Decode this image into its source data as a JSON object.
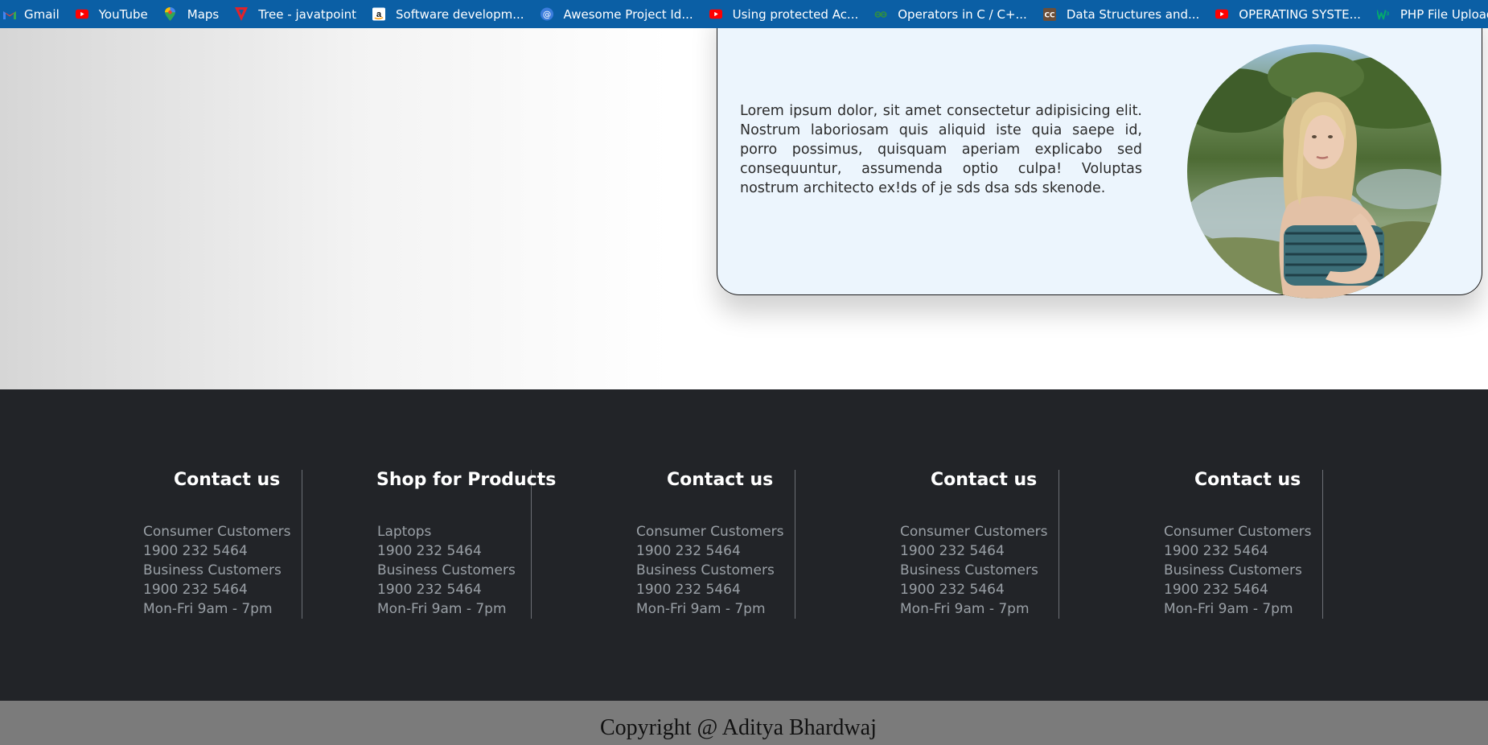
{
  "bookmarks": [
    {
      "label": "Gmail",
      "icon": "gmail-icon"
    },
    {
      "label": "YouTube",
      "icon": "youtube-icon"
    },
    {
      "label": "Maps",
      "icon": "maps-icon"
    },
    {
      "label": "Tree - javatpoint",
      "icon": "javatpoint-icon"
    },
    {
      "label": "Software developm...",
      "icon": "amazon-icon"
    },
    {
      "label": "Awesome Project Id...",
      "icon": "at-sign-icon"
    },
    {
      "label": "Using protected Ac...",
      "icon": "youtube-icon"
    },
    {
      "label": "Operators in C / C+...",
      "icon": "geeksforgeeks-icon"
    },
    {
      "label": "Data Structures and...",
      "icon": "codechef-icon"
    },
    {
      "label": "OPERATING SYSTE...",
      "icon": "youtube-icon"
    },
    {
      "label": "PHP File Upload",
      "icon": "w3schools-icon"
    }
  ],
  "card": {
    "text": "Lorem ipsum dolor, sit amet consectetur adipisicing elit. Nostrum laboriosam quis aliquid iste quia saepe id, porro possimus, quisquam aperiam explicabo sed consequuntur, assumenda optio culpa! Voluptas nostrum architecto ex!ds of je sds dsa sds skenode."
  },
  "footer": {
    "columns": [
      {
        "title": "Contact us",
        "lines": [
          "Consumer Customers",
          "1900 232 5464",
          "Business Customers",
          "1900 232 5464",
          "Mon-Fri 9am - 7pm"
        ]
      },
      {
        "title": "Shop for Products",
        "lines": [
          "Laptops",
          "1900 232 5464",
          "Business Customers",
          "1900 232 5464",
          "Mon-Fri 9am - 7pm"
        ]
      },
      {
        "title": "Contact us",
        "lines": [
          "Consumer Customers",
          "1900 232 5464",
          "Business Customers",
          "1900 232 5464",
          "Mon-Fri 9am - 7pm"
        ]
      },
      {
        "title": "Contact us",
        "lines": [
          "Consumer Customers",
          "1900 232 5464",
          "Business Customers",
          "1900 232 5464",
          "Mon-Fri 9am - 7pm"
        ]
      },
      {
        "title": "Contact us",
        "lines": [
          "Consumer Customers",
          "1900 232 5464",
          "Business Customers",
          "1900 232 5464",
          "Mon-Fri 9am - 7pm"
        ]
      }
    ],
    "copyright": "Copyright @ Aditya Bhardwaj"
  },
  "colors": {
    "bookmarks_bar": "#0b5fa5",
    "card_bg": "#ecf5fd",
    "footer_bg": "#222428",
    "copyright_bg": "#7b7b7b"
  }
}
